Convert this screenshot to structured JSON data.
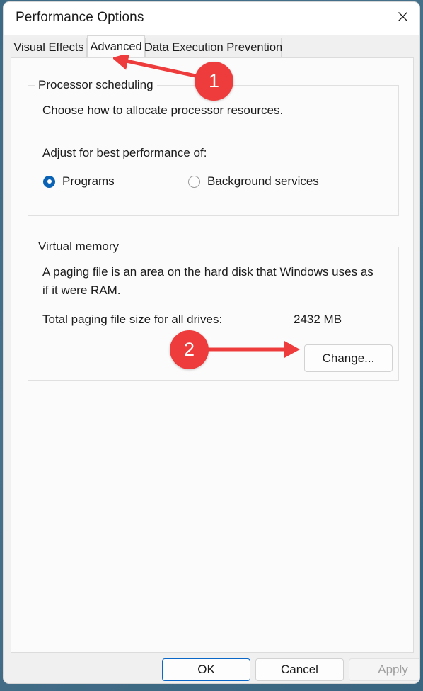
{
  "window": {
    "title": "Performance Options",
    "close_icon": "close-icon"
  },
  "tabs": [
    {
      "label": "Visual Effects",
      "selected": false
    },
    {
      "label": "Advanced",
      "selected": true
    },
    {
      "label": "Data Execution Prevention",
      "selected": false
    }
  ],
  "processor_scheduling": {
    "group_label": "Processor scheduling",
    "description": "Choose how to allocate processor resources.",
    "adjust_label": "Adjust for best performance of:",
    "options": [
      {
        "label": "Programs",
        "checked": true
      },
      {
        "label": "Background services",
        "checked": false
      }
    ]
  },
  "virtual_memory": {
    "group_label": "Virtual memory",
    "description": "A paging file is an area on the hard disk that Windows uses as if it were RAM.",
    "total_label": "Total paging file size for all drives:",
    "total_value": "2432 MB",
    "change_button": "Change..."
  },
  "footer": {
    "ok": "OK",
    "cancel": "Cancel",
    "apply": "Apply"
  },
  "annotations": {
    "accent_color": "#ee3c3c",
    "markers": [
      {
        "number": "1",
        "target": "advanced-tab"
      },
      {
        "number": "2",
        "target": "change-button"
      }
    ]
  }
}
